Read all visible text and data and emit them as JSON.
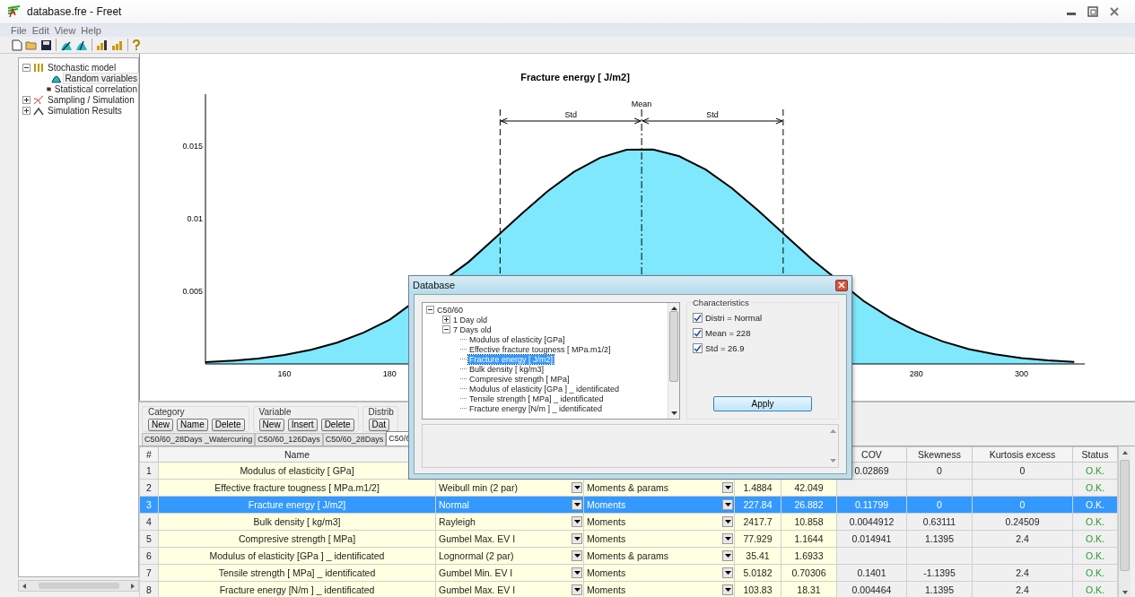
{
  "window": {
    "title": "database.fre - Freet"
  },
  "menu": [
    "File",
    "Edit",
    "View",
    "Help"
  ],
  "tree": [
    {
      "label": "Stochastic model",
      "expanded": true,
      "selected": false,
      "children": [
        {
          "label": "Random variables",
          "selected": true
        },
        {
          "label": "Statistical correlation",
          "selected": false
        }
      ]
    },
    {
      "label": "Sampling / Simulation",
      "expanded": false,
      "selected": false
    },
    {
      "label": "Simulation Results",
      "expanded": false,
      "selected": false
    }
  ],
  "chart": {
    "chart_data": {
      "type": "area",
      "title": "Fracture energy [ J/m2]",
      "xlim": [
        145,
        312
      ],
      "ylim": [
        0,
        0.0186
      ],
      "xticks": [
        160,
        180,
        280,
        300
      ],
      "yticks": [
        {
          "value": 0.005,
          "label": "0.005"
        },
        {
          "value": 0.01,
          "label": "0.01"
        },
        {
          "value": 0.015,
          "label": "0.015"
        }
      ],
      "x": [
        145,
        150,
        155,
        160,
        165,
        170,
        175,
        180,
        185,
        190,
        195,
        200,
        205,
        210,
        215,
        220,
        225,
        230,
        235,
        240,
        245,
        250,
        255,
        260,
        265,
        270,
        275,
        280,
        285,
        290,
        295,
        300,
        305,
        310
      ],
      "series": [
        {
          "color": "#80e8fc",
          "values": [
            0.00013,
            0.00022,
            0.00038,
            0.00061,
            0.00097,
            0.00147,
            0.00215,
            0.00305,
            null,
            null,
            0.00704,
            0.00868,
            0.01034,
            0.01191,
            0.01324,
            0.01422,
            0.01476,
            0.01479,
            0.01432,
            0.0134,
            0.01211,
            0.01057,
            0.00891,
            0.00726,
            null,
            0.00434,
            0.00319,
            0.00226,
            0.00155,
            0.00102,
            0.00066,
            0.0004,
            0.00024,
            0.00014
          ]
        }
      ],
      "ref_lines": [
        {
          "axis": "x",
          "value": 200.96
        },
        {
          "axis": "x",
          "value": 227.84
        },
        {
          "axis": "x",
          "value": 254.72
        }
      ],
      "annotations": [
        "Mean",
        "Std",
        "Std"
      ]
    }
  },
  "groups": [
    {
      "title": "Category",
      "buttons": [
        "New",
        "Name",
        "Delete"
      ]
    },
    {
      "title": "Variable",
      "buttons": [
        "New",
        "Insert",
        "Delete"
      ]
    },
    {
      "title": "Distrib",
      "buttons": [
        "Dat"
      ]
    }
  ],
  "sheet_tabs": [
    {
      "label": "C50/60_28Days _Watercuring",
      "selected": false
    },
    {
      "label": "C50/60_126Days",
      "selected": false
    },
    {
      "label": "C50/60_28Days",
      "selected": false
    },
    {
      "label": "C50/6",
      "selected": true
    }
  ],
  "table": {
    "columns": {
      "number": "#",
      "name": "Name",
      "cov": "COV",
      "skewness": "Skewness",
      "kurtosis": "Kurtosis excess",
      "status": "Status"
    },
    "rows": [
      {
        "number": "1",
        "name": "Modulus of elasticity [ GPa]",
        "cov": "0.02869",
        "skewness": "0",
        "kurtosis": "0",
        "status": "O.K.",
        "selected": false
      },
      {
        "number": "2",
        "name": "Effective fracture tougness [ MPa.m1/2]",
        "distribution": "Weibull min (2 par)",
        "method": "Moments & params",
        "mean": "1.4884",
        "std": "42.049",
        "status": "O.K.",
        "selected": false
      },
      {
        "number": "3",
        "name": "Fracture energy [ J/m2]",
        "distribution": "Normal",
        "method": "Moments",
        "mean": "227.84",
        "std": "26.882",
        "cov": "0.11799",
        "skewness": "0",
        "kurtosis": "0",
        "status": "O.K.",
        "selected": true
      },
      {
        "number": "4",
        "name": "Bulk density  [ kg/m3]",
        "distribution": "Rayleigh",
        "method": "Moments",
        "mean": "2417.7",
        "std": "10.858",
        "cov": "0.0044912",
        "skewness": "0.63111",
        "kurtosis": "0.24509",
        "status": "O.K.",
        "selected": false
      },
      {
        "number": "5",
        "name": "Compresive strength  [ MPa]",
        "distribution": "Gumbel Max. EV I",
        "method": "Moments",
        "mean": "77.929",
        "std": "1.1644",
        "cov": "0.014941",
        "skewness": "1.1395",
        "kurtosis": "2.4",
        "status": "O.K.",
        "selected": false
      },
      {
        "number": "6",
        "name": "Modulus of elasticity  [GPa ] _ identificated",
        "distribution": "Lognormal (2 par)",
        "method": "Moments & params",
        "mean": "35.41",
        "std": "1.6933",
        "status": "O.K.",
        "selected": false
      },
      {
        "number": "7",
        "name": "Tensile strength [ MPa] _ identificated",
        "distribution": "Gumbel Min. EV I",
        "method": "Moments",
        "mean": "5.0182",
        "std": "0.70306",
        "cov": "0.1401",
        "skewness": "-1.1395",
        "kurtosis": "2.4",
        "status": "O.K.",
        "selected": false
      },
      {
        "number": "8",
        "name": "Fracture energy [N/m ] _ identificated",
        "distribution": "Gumbel Max. EV I",
        "method": "Moments",
        "mean": "103.83",
        "std": "18.31",
        "cov": "0.004464",
        "skewness": "1.1395",
        "kurtosis": "2.4",
        "status": "O.K.",
        "selected": false
      }
    ]
  },
  "dialog": {
    "title": "Database",
    "tree": [
      {
        "label": "C50/60",
        "expanded": true,
        "selected": false,
        "children": [
          {
            "label": "1 Day old",
            "expanded": false,
            "selected": false
          },
          {
            "label": "7 Days old",
            "expanded": true,
            "selected": false,
            "children": [
              {
                "label": "Modulus of elasticity [GPa]",
                "selected": false
              },
              {
                "label": "Effective fracture tougness [ MPa.m1/2]",
                "selected": false
              },
              {
                "label": "Fracture energy [ J/m2]",
                "selected": true
              },
              {
                "label": "Bulk density  [ kg/m3]",
                "selected": false
              },
              {
                "label": "Compresive strength  [ MPa]",
                "selected": false
              },
              {
                "label": "Modulus of elasticity  [GPa ] _ identificated",
                "selected": false
              },
              {
                "label": "Tensile strength [ MPa] _ identificated",
                "selected": false
              },
              {
                "label": "Fracture energy [N/m ] _ identificated",
                "selected": false
              }
            ]
          }
        ]
      }
    ],
    "characteristics": {
      "title": "Characteristics",
      "items": [
        {
          "label": "Distri = Normal",
          "checked": true
        },
        {
          "label": "Mean = 228",
          "checked": true
        },
        {
          "label": "Std = 26.9",
          "checked": true
        }
      ]
    },
    "apply": "Apply"
  }
}
